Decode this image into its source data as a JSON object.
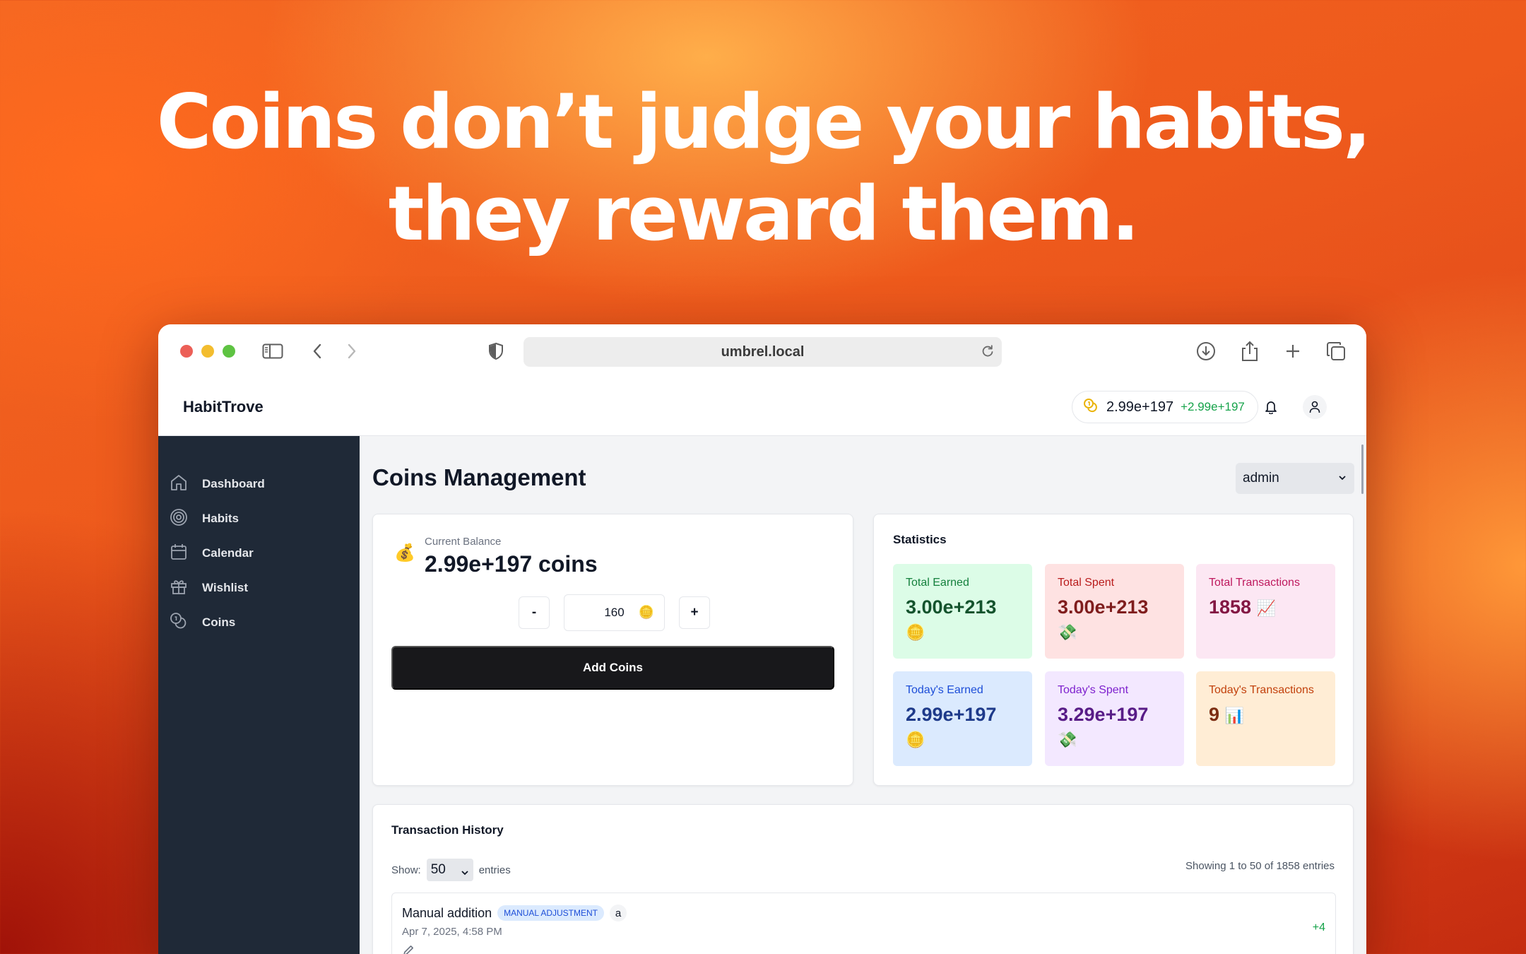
{
  "headline": {
    "line1": "Coins don’t judge your habits,",
    "line2": "they reward them."
  },
  "browser": {
    "url": "umbrel.local"
  },
  "header": {
    "brand": "HabitTrove",
    "balance": "2.99e+197",
    "balance_delta": "+2.99e+197"
  },
  "sidebar": {
    "items": [
      {
        "label": "Dashboard",
        "icon": "home-icon"
      },
      {
        "label": "Habits",
        "icon": "target-icon"
      },
      {
        "label": "Calendar",
        "icon": "calendar-icon"
      },
      {
        "label": "Wishlist",
        "icon": "gift-icon"
      },
      {
        "label": "Coins",
        "icon": "coins-icon"
      }
    ]
  },
  "main": {
    "title": "Coins Management",
    "user_select": "admin"
  },
  "balance_card": {
    "emoji": "💰",
    "label": "Current Balance",
    "value": "2.99e+197 coins",
    "minus_label": "-",
    "plus_label": "+",
    "quantity": "160",
    "coin_emoji": "🪙",
    "add_button": "Add Coins"
  },
  "statistics": {
    "title": "Statistics",
    "boxes": [
      {
        "label": "Total Earned",
        "value": "3.00e+213",
        "emoji": "🪙",
        "bg": "#dcfce7",
        "label_color": "#15803d",
        "value_color": "#14532d"
      },
      {
        "label": "Total Spent",
        "value": "3.00e+213",
        "emoji": "💸",
        "bg": "#fee2e2",
        "label_color": "#b91c1c",
        "value_color": "#7f1d1d"
      },
      {
        "label": "Total Transactions",
        "value": "1858",
        "emoji": "📈",
        "bg": "#fce7f3",
        "label_color": "#be185d",
        "value_color": "#831843"
      },
      {
        "label": "Today's Earned",
        "value": "2.99e+197",
        "emoji": "🪙",
        "bg": "#dbeafe",
        "label_color": "#1d4ed8",
        "value_color": "#1e3a8a"
      },
      {
        "label": "Today's Spent",
        "value": "3.29e+197",
        "emoji": "💸",
        "bg": "#f3e8ff",
        "label_color": "#7e22ce",
        "value_color": "#581c87"
      },
      {
        "label": "Today's Transactions",
        "value": "9",
        "emoji": "📊",
        "bg": "#ffedd5",
        "label_color": "#c2410c",
        "value_color": "#7c2d12"
      }
    ]
  },
  "history": {
    "title": "Transaction History",
    "show_label": "Show:",
    "page_size": "50",
    "entries_label": "entries",
    "count_text": "Showing 1 to 50 of 1858 entries",
    "rows": [
      {
        "title": "Manual addition",
        "badge": "MANUAL ADJUSTMENT",
        "user": "a",
        "date": "Apr 7, 2025, 4:58 PM",
        "amount": "+4"
      }
    ]
  },
  "colors": {
    "sidebar_bg": "#1f2937",
    "primary_button": "#18181b",
    "positive": "#16a34a"
  }
}
